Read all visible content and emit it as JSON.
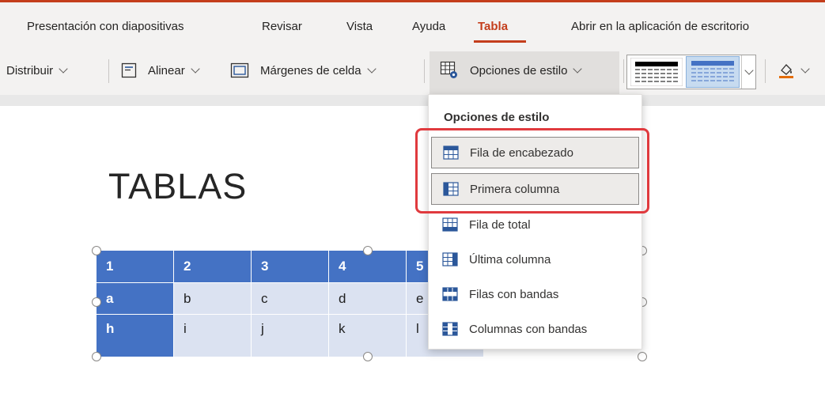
{
  "ribbon": {
    "tabs": [
      {
        "label": "Presentación con diapositivas"
      },
      {
        "label": "Revisar"
      },
      {
        "label": "Vista"
      },
      {
        "label": "Ayuda"
      },
      {
        "label": "Tabla",
        "active": true
      },
      {
        "label": "Abrir en la aplicación de escritorio"
      }
    ],
    "toolbar": {
      "distribuir_label": "Distribuir",
      "alinear_label": "Alinear",
      "margenes_label": "Márgenes de celda",
      "opciones_estilo_label": "Opciones de estilo"
    },
    "accent_color": "#c43e1c"
  },
  "slide": {
    "title": "TABLAS",
    "table": {
      "header": [
        "1",
        "2",
        "3",
        "4",
        "5"
      ],
      "rows": [
        [
          "a",
          "b",
          "c",
          "d",
          "e"
        ],
        [
          "h",
          "i",
          "j",
          "k",
          "l"
        ]
      ],
      "header_color": "#4472c4",
      "band_color": "#dbe2f1"
    }
  },
  "dropdown": {
    "title": "Opciones de estilo",
    "items": [
      {
        "label": "Fila de encabezado",
        "checked": true
      },
      {
        "label": "Primera columna",
        "checked": true
      },
      {
        "label": "Fila de total",
        "checked": false
      },
      {
        "label": "Última columna",
        "checked": false
      },
      {
        "label": "Filas con bandas",
        "checked": false
      },
      {
        "label": "Columnas con bandas",
        "checked": false
      }
    ],
    "highlight_color": "#e03a3e"
  }
}
